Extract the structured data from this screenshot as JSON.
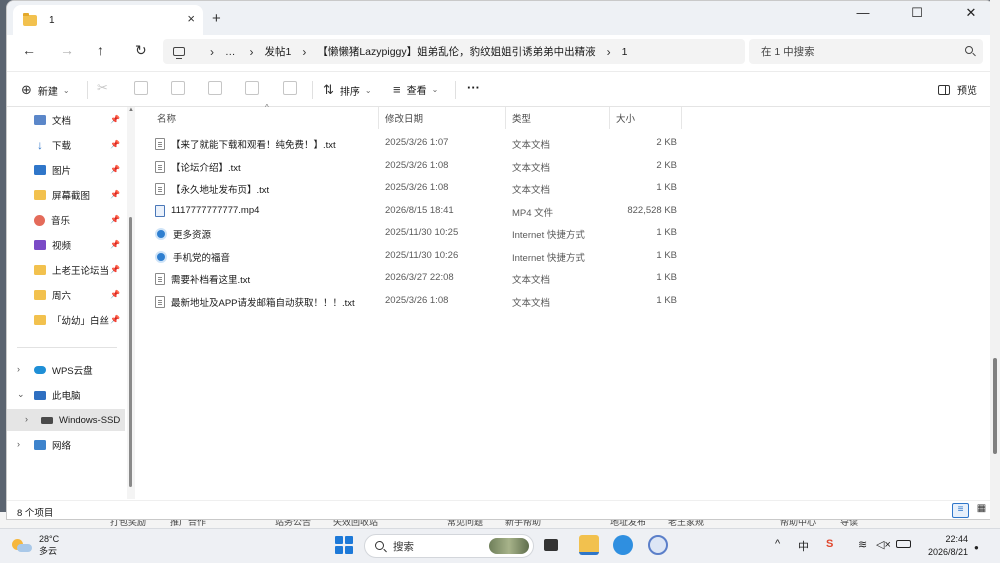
{
  "window": {
    "tab_title": "1",
    "close_tab": "×",
    "new_tab": "+",
    "minimize": "—",
    "maximize": "☐",
    "close": "✕"
  },
  "nav": {
    "back": "←",
    "forward": "→",
    "up": "↑",
    "refresh": "↻",
    "breadcrumb": [
      "…",
      "发帖1",
      "【懒懒猪Lazypiggy】姐弟乱伦，豹纹姐姐引诱弟弟中出精液",
      "1"
    ],
    "search_placeholder": "在 1 中搜索"
  },
  "toolbar": {
    "new_label": "新建",
    "sort_label": "排序",
    "view_label": "查看",
    "more_label": "···",
    "preview_label": "预览"
  },
  "sidebar": {
    "quick_access": [
      {
        "label": "文档",
        "icon": "document-folder-icon"
      },
      {
        "label": "下载",
        "icon": "download-icon"
      },
      {
        "label": "图片",
        "icon": "pictures-icon"
      },
      {
        "label": "屏幕截图",
        "icon": "folder-icon"
      },
      {
        "label": "音乐",
        "icon": "music-icon"
      },
      {
        "label": "视频",
        "icon": "video-icon"
      },
      {
        "label": "上老王论坛当",
        "icon": "folder-icon"
      },
      {
        "label": "周六",
        "icon": "folder-icon"
      },
      {
        "label": "「幼幼」白丝",
        "icon": "folder-icon"
      }
    ],
    "tree": [
      {
        "label": "WPS云盘",
        "chev": "›"
      },
      {
        "label": "此电脑",
        "chev": "⌄"
      },
      {
        "label": "Windows-SSD",
        "chev": "›"
      },
      {
        "label": "网络",
        "chev": "›"
      }
    ],
    "pin_glyph": "📌"
  },
  "columns": {
    "name": "名称",
    "date": "修改日期",
    "type": "类型",
    "size": "大小"
  },
  "files": [
    {
      "name": "【来了就能下载和观看！纯免费！】.txt",
      "date": "2025/3/26 1:07",
      "type": "文本文档",
      "size": "2 KB",
      "kind": "txt"
    },
    {
      "name": "【论坛介绍】.txt",
      "date": "2025/3/26 1:08",
      "type": "文本文档",
      "size": "2 KB",
      "kind": "txt"
    },
    {
      "name": "【永久地址发布页】.txt",
      "date": "2025/3/26 1:08",
      "type": "文本文档",
      "size": "1 KB",
      "kind": "txt"
    },
    {
      "name": "1117777777777.mp4",
      "date": "2026/8/15 18:41",
      "type": "MP4 文件",
      "size": "822,528 KB",
      "kind": "mp4"
    },
    {
      "name": "更多资源",
      "date": "2025/11/30 10:25",
      "type": "Internet 快捷方式",
      "size": "1 KB",
      "kind": "url"
    },
    {
      "name": "手机党的福音",
      "date": "2025/11/30 10:26",
      "type": "Internet 快捷方式",
      "size": "1 KB",
      "kind": "url"
    },
    {
      "name": "需要补档看这里.txt",
      "date": "2026/3/27 22:08",
      "type": "文本文档",
      "size": "1 KB",
      "kind": "txt"
    },
    {
      "name": "最新地址及APP请发邮箱自动获取！！！.txt",
      "date": "2025/3/26 1:08",
      "type": "文本文档",
      "size": "1 KB",
      "kind": "txt"
    }
  ],
  "status": {
    "item_count": "8 个项目"
  },
  "background_strip": [
    "打包奖励",
    "推广合作",
    "站务公告",
    "失效回收站",
    "常见问题",
    "新手帮助",
    "地址发布",
    "老王家规",
    "帮助中心",
    "导读"
  ],
  "taskbar": {
    "temperature": "28°C",
    "condition": "多云",
    "search_label": "搜索",
    "ime_label": "中",
    "time": "22:44",
    "date": "2026/8/21"
  },
  "colors": {
    "accent": "#2f76c9",
    "folder": "#f2c14e",
    "taskbar": "#eef0f4"
  }
}
